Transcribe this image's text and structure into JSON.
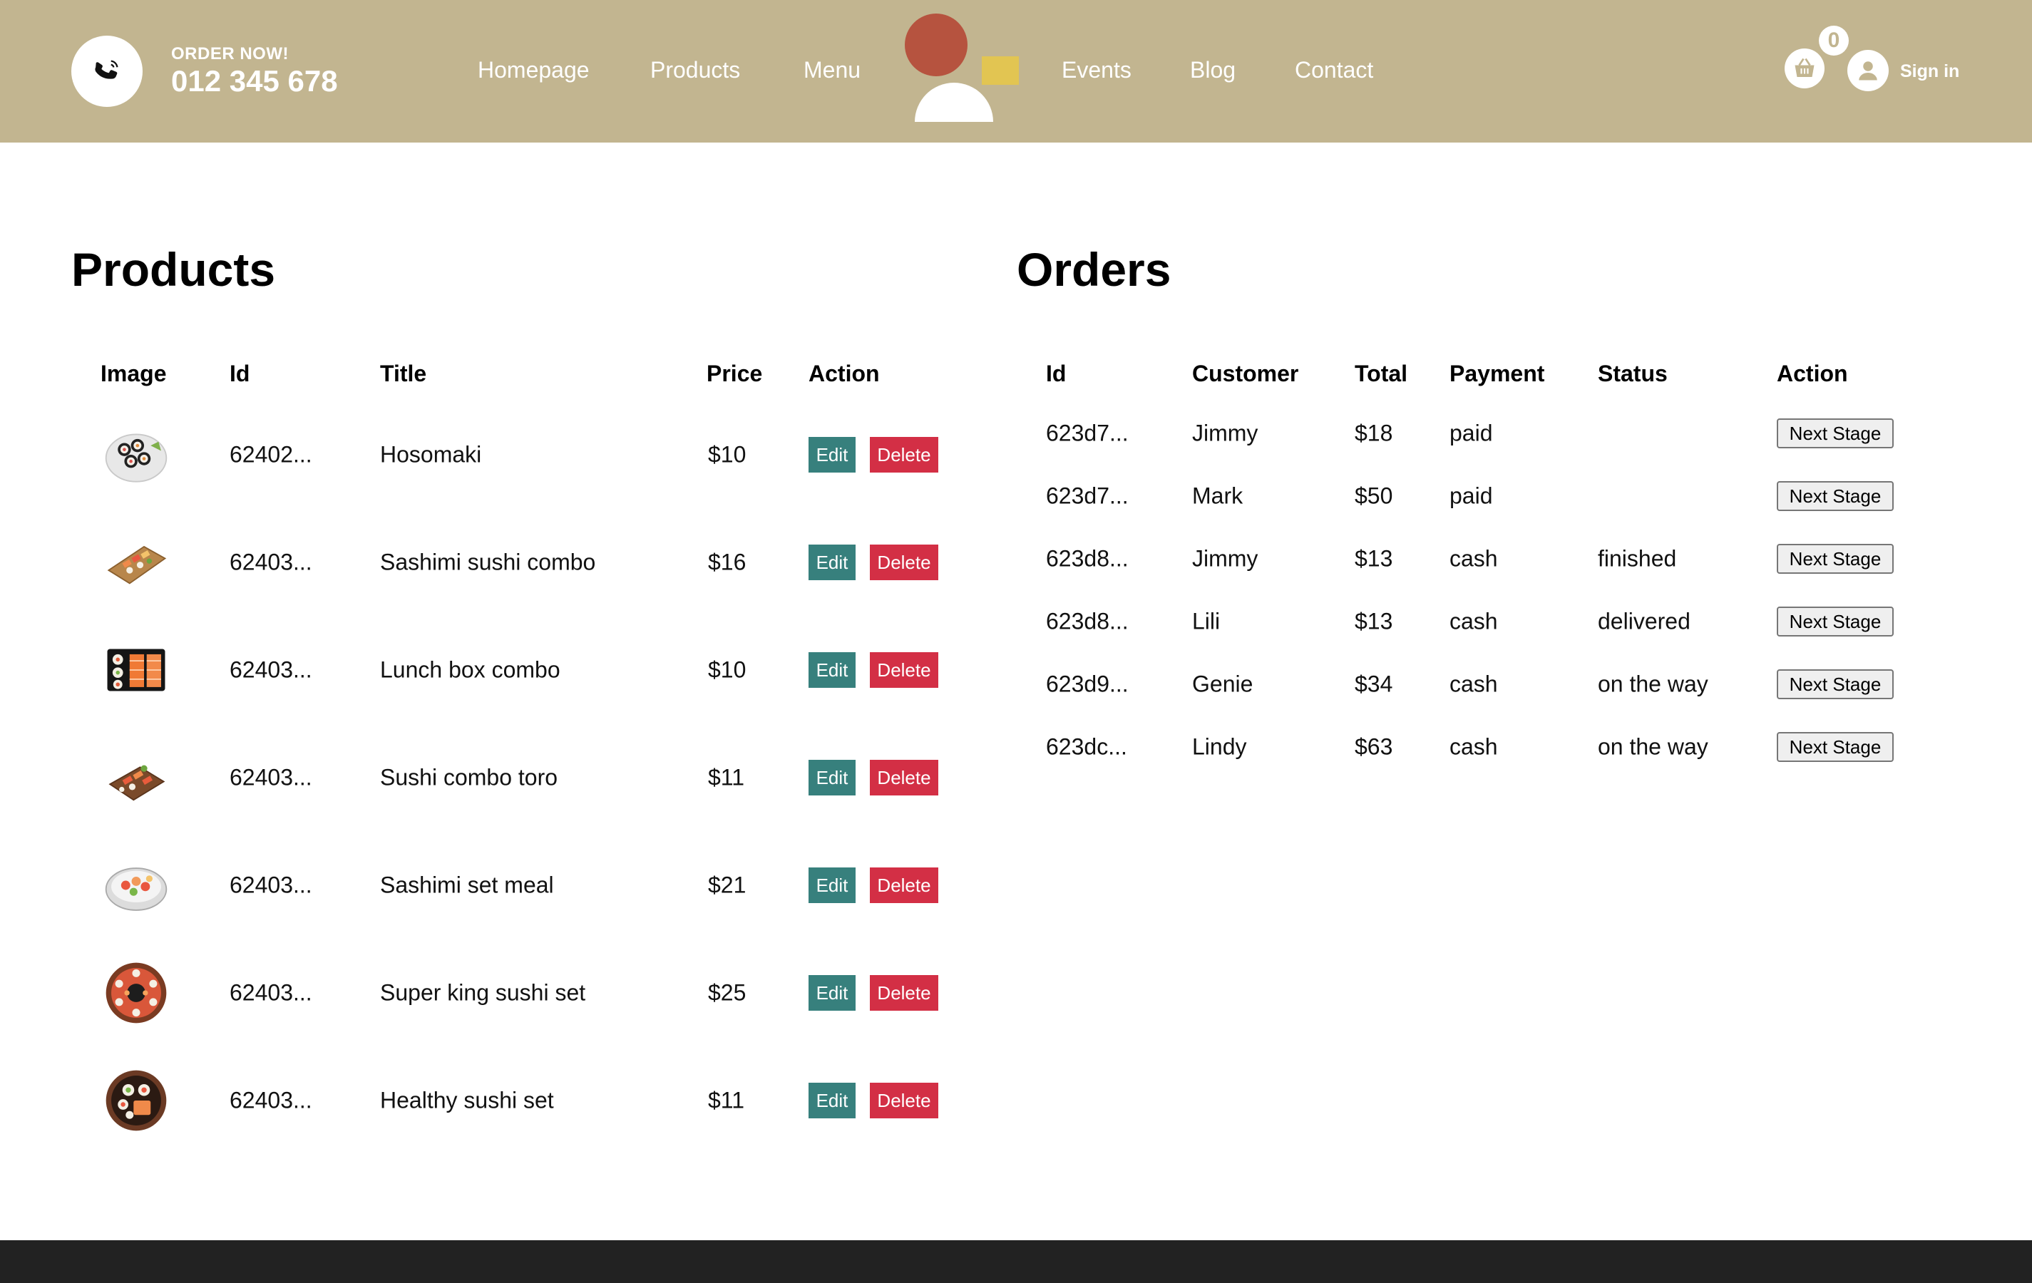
{
  "header": {
    "order_now": "ORDER NOW!",
    "phone": "012 345 678",
    "nav": [
      "Homepage",
      "Products",
      "Menu",
      "Events",
      "Blog",
      "Contact"
    ],
    "cart_count": "0",
    "sign_in": "Sign in",
    "background_color": "#c2b590"
  },
  "products": {
    "title": "Products",
    "columns": [
      "Image",
      "Id",
      "Title",
      "Price",
      "Action"
    ],
    "edit_label": "Edit",
    "delete_label": "Delete",
    "rows": [
      {
        "id": "62402...",
        "title": "Hosomaki",
        "price": "$10",
        "image": "hosomaki-plate"
      },
      {
        "id": "62403...",
        "title": "Sashimi sushi combo",
        "price": "$16",
        "image": "sushi-board"
      },
      {
        "id": "62403...",
        "title": "Lunch box combo",
        "price": "$10",
        "image": "lunch-box"
      },
      {
        "id": "62403...",
        "title": "Sushi combo toro",
        "price": "$11",
        "image": "toro-board"
      },
      {
        "id": "62403...",
        "title": "Sashimi set meal",
        "price": "$21",
        "image": "sashimi-plate"
      },
      {
        "id": "62403...",
        "title": "Super king sushi set",
        "price": "$25",
        "image": "round-platter"
      },
      {
        "id": "62403...",
        "title": "Healthy sushi set",
        "price": "$11",
        "image": "round-bowl"
      }
    ]
  },
  "orders": {
    "title": "Orders",
    "columns": [
      "Id",
      "Customer",
      "Total",
      "Payment",
      "Status",
      "Action"
    ],
    "action_label": "Next Stage",
    "rows": [
      {
        "id": "623d7...",
        "customer": "Jimmy",
        "total": "$18",
        "payment": "paid",
        "status": ""
      },
      {
        "id": "623d7...",
        "customer": "Mark",
        "total": "$50",
        "payment": "paid",
        "status": ""
      },
      {
        "id": "623d8...",
        "customer": "Jimmy",
        "total": "$13",
        "payment": "cash",
        "status": "finished"
      },
      {
        "id": "623d8...",
        "customer": "Lili",
        "total": "$13",
        "payment": "cash",
        "status": "delivered"
      },
      {
        "id": "623d9...",
        "customer": "Genie",
        "total": "$34",
        "payment": "cash",
        "status": "on the way"
      },
      {
        "id": "623dc...",
        "customer": "Lindy",
        "total": "$63",
        "payment": "cash",
        "status": "on the way"
      }
    ]
  },
  "colors": {
    "edit": "#37807d",
    "delete": "#d32f45",
    "footer": "#222222"
  }
}
